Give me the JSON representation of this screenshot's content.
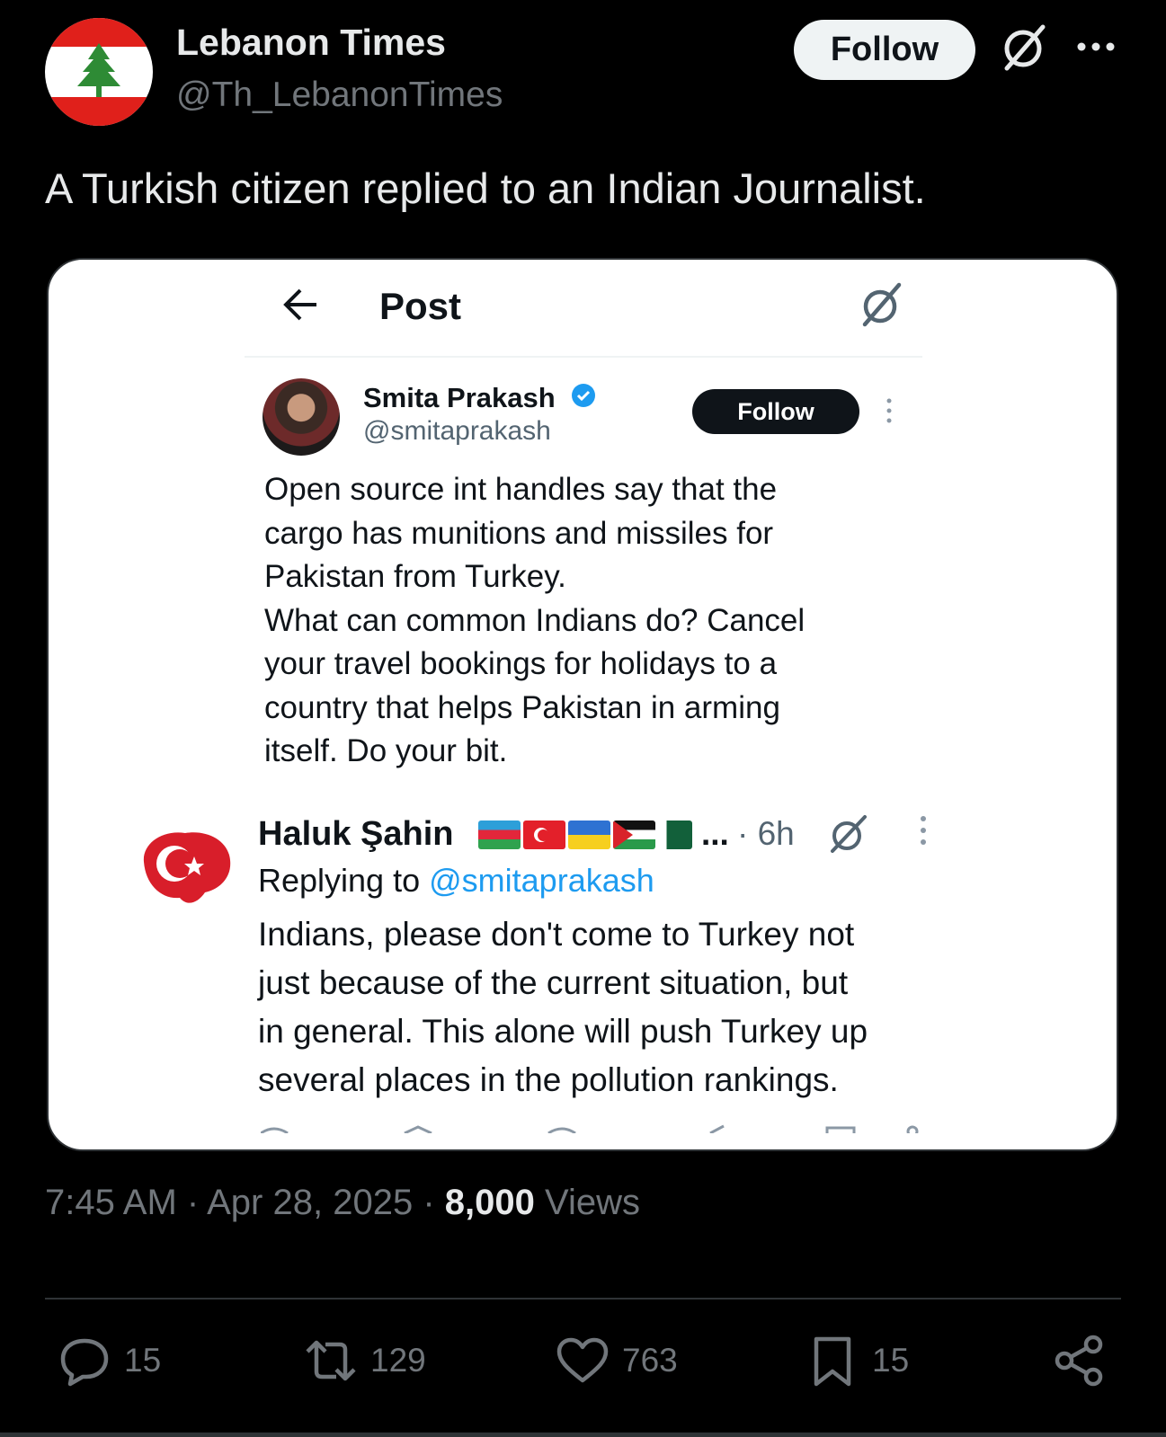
{
  "header": {
    "display_name": "Lebanon Times",
    "handle": "@Th_LebanonTimes",
    "follow_label": "Follow"
  },
  "tweet": {
    "text": "A Turkish citizen replied to an Indian Journalist."
  },
  "embedded_screenshot": {
    "page_title": "Post",
    "original_post": {
      "author_name": "Smita Prakash",
      "author_handle": "@smitaprakash",
      "follow_label": "Follow",
      "text_lines": [
        "Open source int handles say that the",
        "cargo has munitions and missiles for",
        "Pakistan from Turkey.",
        "What can common Indians do? Cancel",
        "your travel bookings for holidays to a",
        "country that helps Pakistan in arming",
        "itself. Do your bit."
      ]
    },
    "reply": {
      "author_name": "Haluk Şahin",
      "name_ellipsis": "...",
      "time": "· 6h",
      "replying_prefix": "Replying to",
      "replying_to": "@smitaprakash",
      "text_lines": [
        "Indians, please don't come to Turkey not",
        "just because of the current situation, but",
        "in general. This alone will push Turkey up",
        "several places in the pollution rankings."
      ]
    }
  },
  "meta": {
    "time": "7:45 AM",
    "date": "Apr 28, 2025",
    "separator": "·",
    "views_count": "8,000",
    "views_label": "Views"
  },
  "actions": {
    "replies": "15",
    "reposts": "129",
    "likes": "763",
    "bookmarks": "15"
  },
  "icons": {
    "reply": "reply-icon",
    "repost": "repost-icon",
    "like": "heart-icon",
    "bookmark": "bookmark-icon",
    "share": "share-icon",
    "grok": "grok-icon",
    "more": "more-icon",
    "back": "back-arrow-icon",
    "verified": "verified-badge-icon"
  },
  "colors": {
    "background": "#000000",
    "link_blue": "#1d9bf0",
    "secondary_text": "#71767b",
    "lebanon_red": "#e0201b",
    "cedar_green": "#2e8b35"
  }
}
